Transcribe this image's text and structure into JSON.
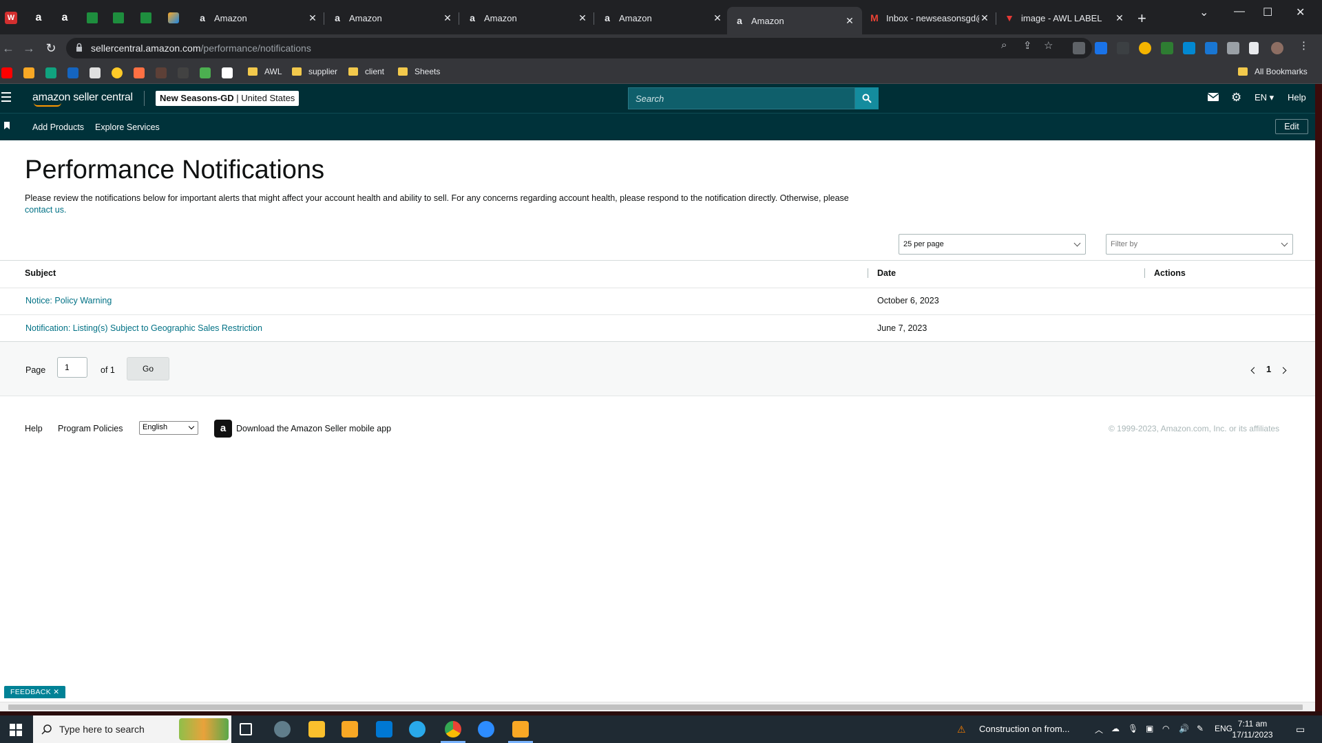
{
  "browser": {
    "tabs": [
      {
        "title": "Amazon",
        "active": false
      },
      {
        "title": "Amazon",
        "active": false
      },
      {
        "title": "Amazon",
        "active": false
      },
      {
        "title": "Amazon",
        "active": false
      },
      {
        "title": "Amazon",
        "active": true
      },
      {
        "title": "Inbox - newseasonsgd@",
        "active": false
      },
      {
        "title": "image - AWL LABEL",
        "active": false
      }
    ],
    "url_host": "sellercentral.amazon.com",
    "url_path": "/performance/notifications",
    "bookmarks": [
      "AWL",
      "supplier",
      "client",
      "Sheets"
    ],
    "all_bookmarks": "All Bookmarks"
  },
  "header": {
    "logo_text": "amazon seller central",
    "store_name": "New Seasons-GD",
    "store_region": "United States",
    "search_placeholder": "Search",
    "language": "EN",
    "help": "Help"
  },
  "subnav": {
    "add_products": "Add Products",
    "explore_services": "Explore Services",
    "edit": "Edit"
  },
  "main": {
    "title": "Performance Notifications",
    "description": "Please review the notifications below for important alerts that might affect your account health and ability to sell. For any concerns regarding account health, please respond to the notification directly. Otherwise, please",
    "contact_link": "contact us.",
    "per_page": "25 per page",
    "filter_placeholder": "Filter by",
    "columns": {
      "subject": "Subject",
      "date": "Date",
      "actions": "Actions"
    },
    "rows": [
      {
        "subject": "Notice: Policy Warning",
        "date": "October 6, 2023"
      },
      {
        "subject": "Notification: Listing(s) Subject to Geographic Sales Restriction",
        "date": "June 7, 2023"
      }
    ],
    "pager": {
      "page_label": "Page",
      "page_value": "1",
      "of_label": "of 1",
      "go": "Go",
      "current": "1"
    }
  },
  "footer": {
    "help": "Help",
    "program_policies": "Program Policies",
    "language": "English",
    "app_text": "Download the Amazon Seller mobile app",
    "copyright": "© 1999-2023, Amazon.com, Inc. or its affiliates"
  },
  "feedback": "FEEDBACK",
  "taskbar": {
    "search_placeholder": "Type here to search",
    "news": "Construction on from...",
    "lang": "ENG",
    "time": "7:11 am",
    "date": "17/11/2023"
  },
  "colors": {
    "header_bg": "#002f36",
    "link": "#007185",
    "search_btn": "#148c9e"
  }
}
